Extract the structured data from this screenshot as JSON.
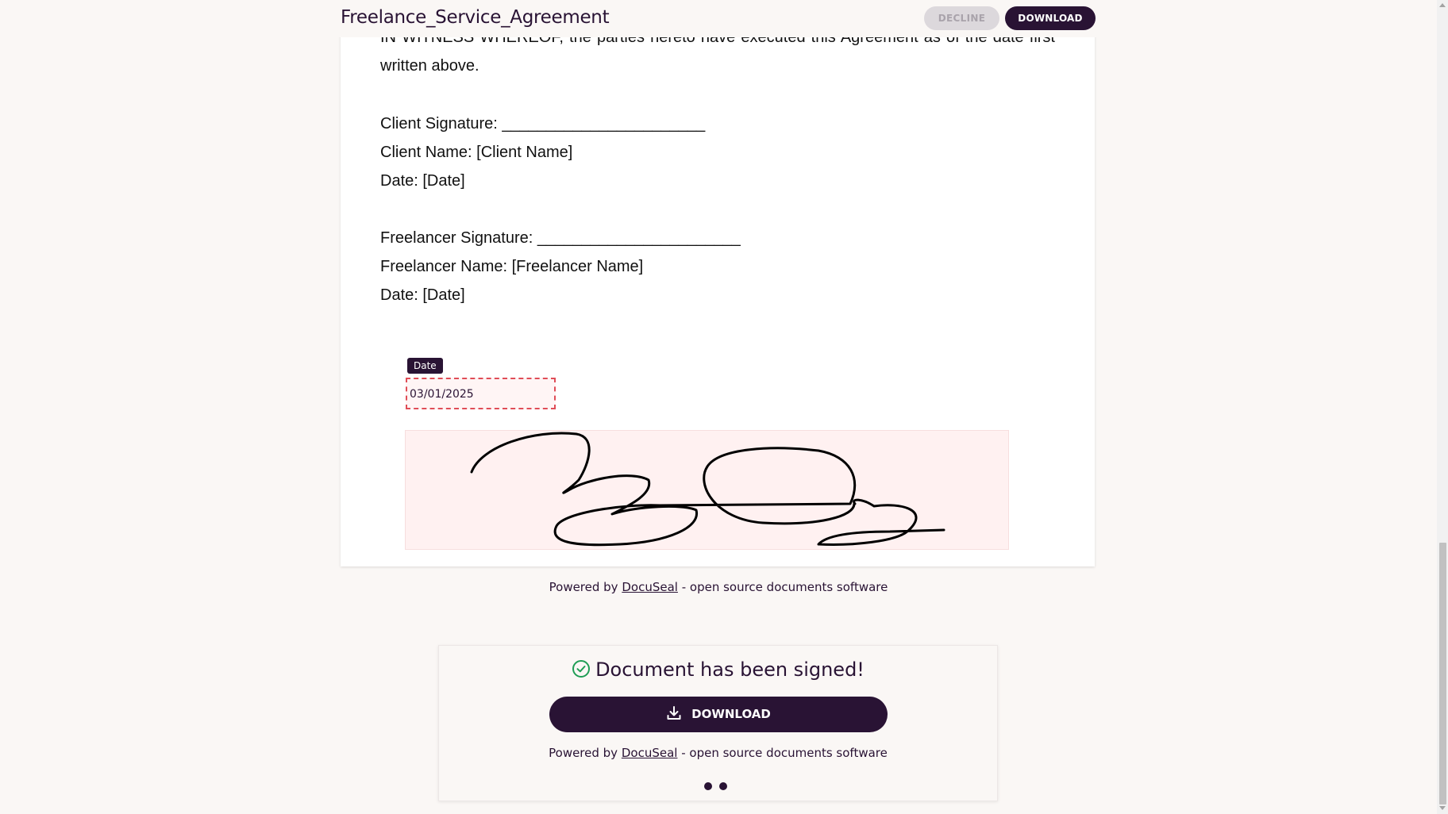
{
  "header": {
    "title": "Freelance_Service_Agreement",
    "decline_label": "DECLINE",
    "download_label": "DOWNLOAD"
  },
  "document": {
    "witness_line_1": "IN WITNESS WHEREOF, the parties hereto have executed this Agreement as of the date first",
    "witness_line_2": "written above.",
    "client_signature": "Client Signature: _______________________",
    "client_name": "Client Name: [Client Name]",
    "client_date": "Date: [Date]",
    "freelancer_signature": "Freelancer Signature: _______________________",
    "freelancer_name": "Freelancer Name: [Freelancer Name]",
    "freelancer_date": "Date: [Date]",
    "date_field_tag": "Date",
    "date_field_value": "03/01/2025",
    "signature_icon": "handwritten-signature"
  },
  "footer": {
    "powered_prefix": "Powered by ",
    "powered_link": "DocuSeal",
    "powered_suffix": " - open source documents software"
  },
  "signed_card": {
    "title": "Document has been signed!",
    "check_icon": "check-circle-icon",
    "download_label": "DOWNLOAD",
    "download_icon": "download-icon",
    "powered_prefix": "Powered by ",
    "powered_link": "DocuSeal",
    "powered_suffix": " - open source documents software"
  },
  "colors": {
    "brand": "#291334",
    "field_border": "#e04d57",
    "signature_bg": "#fff1f1",
    "background": "#faf7f5",
    "check": "#1f9d55"
  }
}
